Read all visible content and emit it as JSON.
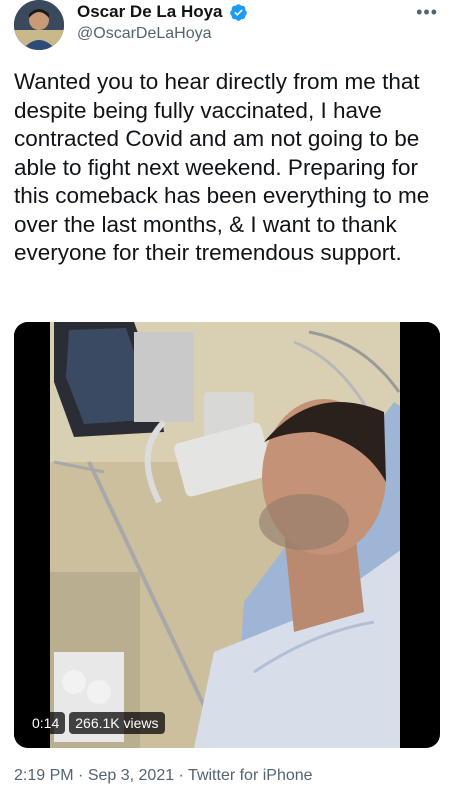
{
  "user": {
    "name": "Oscar De La Hoya",
    "handle": "@OscarDeLaHoya",
    "verified_icon": "verified-badge-icon",
    "accent_color": "#1d9bf0"
  },
  "more_label": "•••",
  "tweet": {
    "text": "Wanted you to hear directly from me that despite being fully vaccinated, I have contracted Covid and am not going to be able to fight next weekend. Preparing for this comeback has been everything to me over the last months, & I want to thank everyone for their tremendous support."
  },
  "video": {
    "elapsed": "0:14",
    "views": "266.1K views"
  },
  "meta": {
    "time": "2:19 PM",
    "sep": " · ",
    "date": "Sep 3, 2021",
    "source": "Twitter for iPhone"
  }
}
